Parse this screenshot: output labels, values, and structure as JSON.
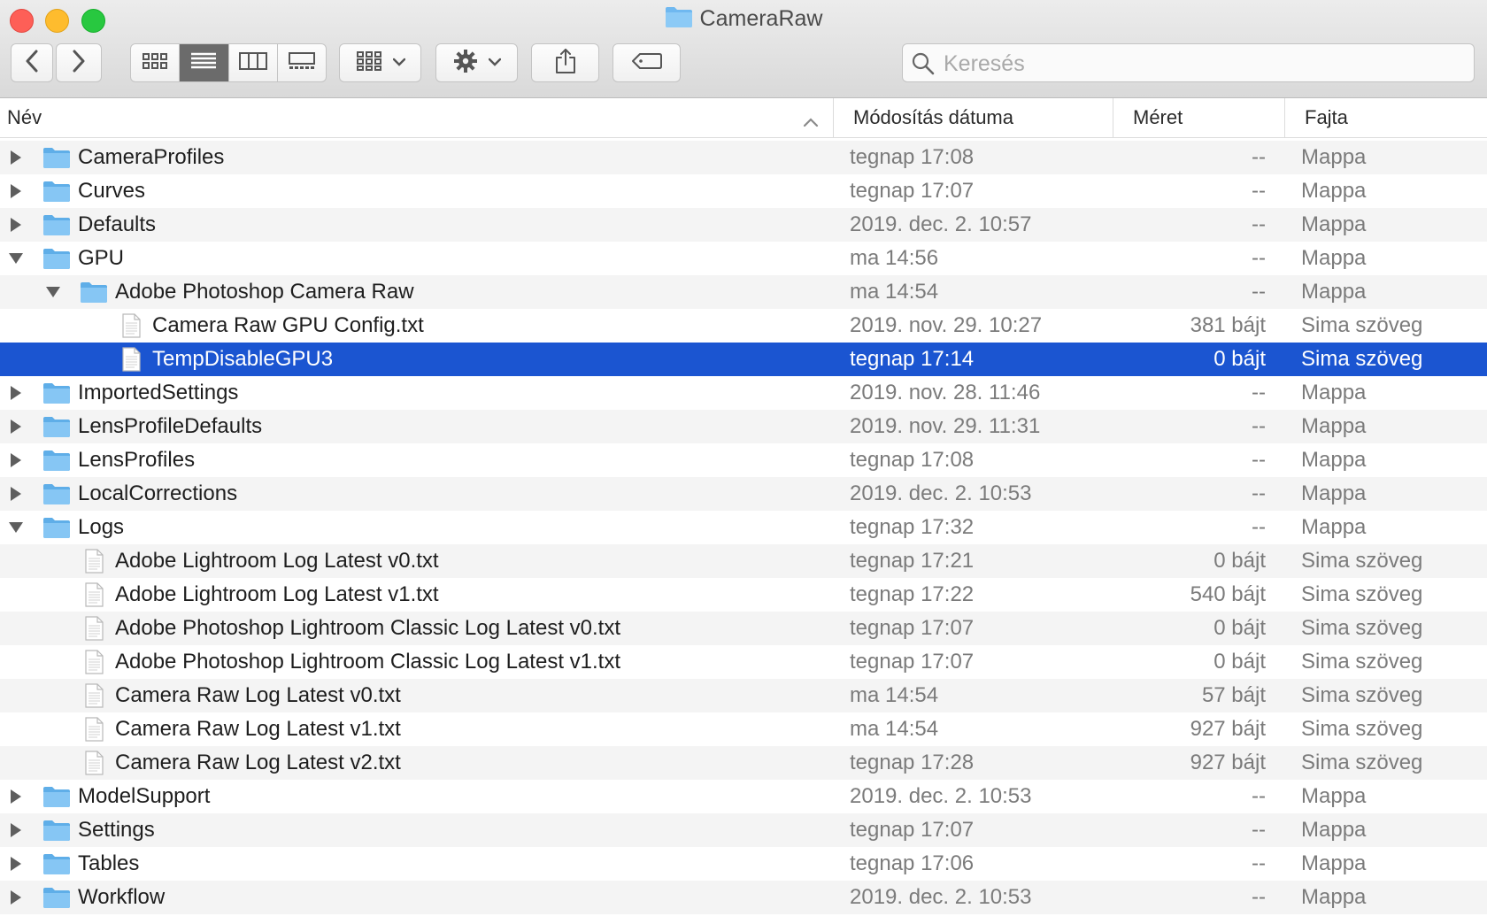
{
  "window": {
    "title": "CameraRaw"
  },
  "toolbar": {
    "search_placeholder": "Keresés",
    "search_value": ""
  },
  "columns": {
    "name": "Név",
    "date": "Módosítás dátuma",
    "size": "Méret",
    "kind": "Fajta"
  },
  "colors": {
    "selection": "#1b55d1",
    "folder": "#6fb8f0",
    "alt_row": "#f4f4f4"
  },
  "rows": [
    {
      "name": "CameraProfiles",
      "date": "tegnap 17:08",
      "size": "--",
      "kind": "Mappa",
      "type": "folder",
      "level": 0,
      "disclosure": "collapsed"
    },
    {
      "name": "Curves",
      "date": "tegnap 17:07",
      "size": "--",
      "kind": "Mappa",
      "type": "folder",
      "level": 0,
      "disclosure": "collapsed"
    },
    {
      "name": "Defaults",
      "date": "2019. dec. 2. 10:57",
      "size": "--",
      "kind": "Mappa",
      "type": "folder",
      "level": 0,
      "disclosure": "collapsed"
    },
    {
      "name": "GPU",
      "date": "ma 14:56",
      "size": "--",
      "kind": "Mappa",
      "type": "folder",
      "level": 0,
      "disclosure": "expanded"
    },
    {
      "name": "Adobe Photoshop Camera Raw",
      "date": "ma 14:54",
      "size": "--",
      "kind": "Mappa",
      "type": "folder",
      "level": 1,
      "disclosure": "expanded"
    },
    {
      "name": "Camera Raw GPU Config.txt",
      "date": "2019. nov. 29. 10:27",
      "size": "381 bájt",
      "kind": "Sima szöveg",
      "type": "file",
      "level": 2,
      "disclosure": "none"
    },
    {
      "name": "TempDisableGPU3",
      "date": "tegnap 17:14",
      "size": "0 bájt",
      "kind": "Sima szöveg",
      "type": "file",
      "level": 2,
      "disclosure": "none",
      "selected": true
    },
    {
      "name": "ImportedSettings",
      "date": "2019. nov. 28. 11:46",
      "size": "--",
      "kind": "Mappa",
      "type": "folder",
      "level": 0,
      "disclosure": "collapsed"
    },
    {
      "name": "LensProfileDefaults",
      "date": "2019. nov. 29. 11:31",
      "size": "--",
      "kind": "Mappa",
      "type": "folder",
      "level": 0,
      "disclosure": "collapsed"
    },
    {
      "name": "LensProfiles",
      "date": "tegnap 17:08",
      "size": "--",
      "kind": "Mappa",
      "type": "folder",
      "level": 0,
      "disclosure": "collapsed"
    },
    {
      "name": "LocalCorrections",
      "date": "2019. dec. 2. 10:53",
      "size": "--",
      "kind": "Mappa",
      "type": "folder",
      "level": 0,
      "disclosure": "collapsed"
    },
    {
      "name": "Logs",
      "date": "tegnap 17:32",
      "size": "--",
      "kind": "Mappa",
      "type": "folder",
      "level": 0,
      "disclosure": "expanded"
    },
    {
      "name": "Adobe Lightroom Log Latest v0.txt",
      "date": "tegnap 17:21",
      "size": "0 bájt",
      "kind": "Sima szöveg",
      "type": "file",
      "level": 1,
      "disclosure": "none"
    },
    {
      "name": "Adobe Lightroom Log Latest v1.txt",
      "date": "tegnap 17:22",
      "size": "540 bájt",
      "kind": "Sima szöveg",
      "type": "file",
      "level": 1,
      "disclosure": "none"
    },
    {
      "name": "Adobe Photoshop Lightroom Classic Log Latest v0.txt",
      "date": "tegnap 17:07",
      "size": "0 bájt",
      "kind": "Sima szöveg",
      "type": "file",
      "level": 1,
      "disclosure": "none"
    },
    {
      "name": "Adobe Photoshop Lightroom Classic Log Latest v1.txt",
      "date": "tegnap 17:07",
      "size": "0 bájt",
      "kind": "Sima szöveg",
      "type": "file",
      "level": 1,
      "disclosure": "none"
    },
    {
      "name": "Camera Raw Log Latest v0.txt",
      "date": "ma 14:54",
      "size": "57 bájt",
      "kind": "Sima szöveg",
      "type": "file",
      "level": 1,
      "disclosure": "none"
    },
    {
      "name": "Camera Raw Log Latest v1.txt",
      "date": "ma 14:54",
      "size": "927 bájt",
      "kind": "Sima szöveg",
      "type": "file",
      "level": 1,
      "disclosure": "none"
    },
    {
      "name": "Camera Raw Log Latest v2.txt",
      "date": "tegnap 17:28",
      "size": "927 bájt",
      "kind": "Sima szöveg",
      "type": "file",
      "level": 1,
      "disclosure": "none"
    },
    {
      "name": "ModelSupport",
      "date": "2019. dec. 2. 10:53",
      "size": "--",
      "kind": "Mappa",
      "type": "folder",
      "level": 0,
      "disclosure": "collapsed"
    },
    {
      "name": "Settings",
      "date": "tegnap 17:07",
      "size": "--",
      "kind": "Mappa",
      "type": "folder",
      "level": 0,
      "disclosure": "collapsed"
    },
    {
      "name": "Tables",
      "date": "tegnap 17:06",
      "size": "--",
      "kind": "Mappa",
      "type": "folder",
      "level": 0,
      "disclosure": "collapsed"
    },
    {
      "name": "Workflow",
      "date": "2019. dec. 2. 10:53",
      "size": "--",
      "kind": "Mappa",
      "type": "folder",
      "level": 0,
      "disclosure": "collapsed"
    }
  ]
}
